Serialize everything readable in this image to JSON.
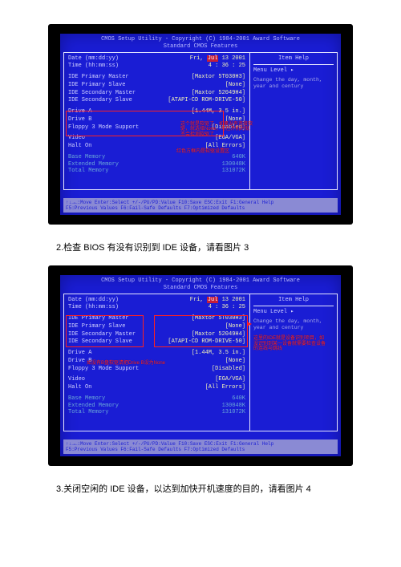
{
  "bios": {
    "header1": "CMOS Setup Utility - Copyright (C) 1984-2001 Award Software",
    "header2": "Standard CMOS Features",
    "date_k": "Date (mm:dd:yy)",
    "date_v1": "Fri,",
    "date_month": "Jul",
    "date_v2": "13 2001",
    "time_k": "Time (hh:mm:ss)",
    "time_v": "4 : 36 : 25",
    "ide_pm_k": "IDE Primary Master",
    "ide_pm_v": "[Maxtor 5T030H3]",
    "ide_ps_k": "IDE Primary Slave",
    "ide_ps_v": "[None]",
    "ide_sm_k": "IDE Secondary Master",
    "ide_sm_v": "[Maxtor 52049H4]",
    "ide_ss_k": "IDE Secondary Slave",
    "ide_ss_v": "[ATAPI-CD ROM-DRIVE-50]",
    "drva_k": "Drive A",
    "drva_v": "[1.44M, 3.5 in.]",
    "drvb_k": "Drive B",
    "drvb_v": "[None]",
    "f3_k": "Floppy 3 Mode Support",
    "f3_v": "[Disabled]",
    "video_k": "Video",
    "video_v": "[EGA/VGA]",
    "halt_k": "Halt On",
    "halt_v": "[All Errors]",
    "bmem_k": "Base Memory",
    "bmem_v": "640K",
    "emem_k": "Extended Memory",
    "emem_v": "130048K",
    "tmem_k": "Total Memory",
    "tmem_v": "131072K",
    "side_title": "Item Help",
    "side_menu": "Menu Level  ▸",
    "side_text": "Change the day, month, year and century",
    "footer1": "↑↓→←:Move  Enter:Select  +/-/PU/PD:Value  F10:Save  ESC:Exit  F1:General Help",
    "footer2": "F5:Previous Values    F6:Fail-Safe Defaults    F7:Optimized Defaults"
  },
  "annot1": {
    "block1": "这个就是软驱了，如果没有连接软驱，就选择None，可在开机时就不会检测软驱了",
    "block2": "红色方框内是软驱设置区"
  },
  "annot2": {
    "ide_note": "这里的IDE就是设备识别项目，如没识别到某一设备就需要检查设备的连线与跳线",
    "b_note": "如没有B盘软驱请把Drive B设为None"
  },
  "captions": {
    "c2": "2.检查 BIOS 有没有识别到 IDE 设备，请看图片 3",
    "c3": "3.关闭空闲的 IDE 设备，以达到加快开机速度的目的，请看图片 4"
  }
}
